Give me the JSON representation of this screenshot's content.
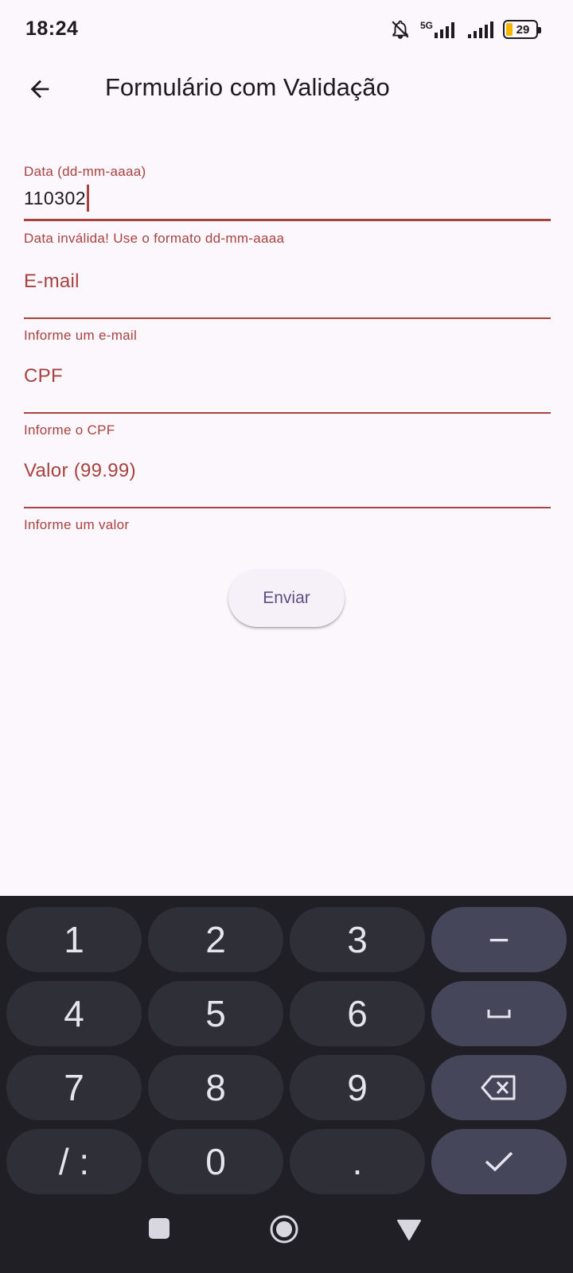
{
  "status_bar": {
    "time": "18:24",
    "network": "5G",
    "battery": "29",
    "icons": [
      "bell-off-icon",
      "signal-5g-icon",
      "signal-icon",
      "battery-icon"
    ]
  },
  "app_bar": {
    "title": "Formulário com Validação",
    "back_icon": "arrow-back-icon"
  },
  "form": {
    "date": {
      "label": "Data (dd-mm-aaaa)",
      "value": "110302",
      "error": "Data inválida! Use o formato dd-mm-aaaa"
    },
    "email": {
      "label": "E-mail",
      "error": "Informe um e-mail"
    },
    "cpf": {
      "label": "CPF",
      "error": "Informe o CPF"
    },
    "valor": {
      "label": "Valor (99.99)",
      "error": "Informe um valor"
    },
    "submit_label": "Enviar"
  },
  "keyboard": {
    "keys": [
      "1",
      "2",
      "3",
      "−",
      "4",
      "5",
      "6",
      "␣",
      "7",
      "8",
      "9",
      "⌫",
      "/ :",
      "0",
      ".",
      "✓"
    ]
  },
  "colors": {
    "background": "#fcf7fc",
    "error": "#a8423f",
    "button_text": "#5d4f84",
    "keyboard_bg": "#1f1f25",
    "key_bg": "#2f2f37",
    "key_fn_bg": "#454659"
  }
}
